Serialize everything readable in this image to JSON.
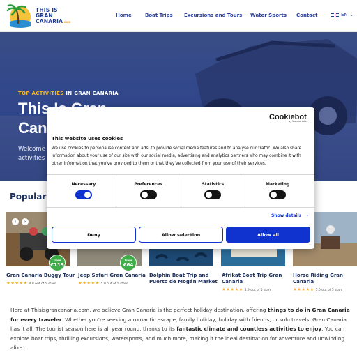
{
  "header": {
    "logo": {
      "line1": "THIS IS",
      "line2": "GRAN",
      "line3": "CANARIA",
      "suffix": ".com"
    },
    "nav": [
      "Home",
      "Boat Trips",
      "Excursions and Tours",
      "Water Sports",
      "Contact"
    ],
    "language": "EN"
  },
  "hero": {
    "kicker_accent": "TOP ACTIVITIES",
    "kicker_rest": " IN GRAN CANARIA",
    "title_line1": "This Is Gran",
    "title_line2": "Canaria",
    "subtitle_line1": "Welcome to",
    "subtitle_line2": "activities in"
  },
  "popular": {
    "title": "Popular Activities",
    "cards": [
      {
        "title_line1": "Gran Canaria Buggy Tour",
        "title_line2": "",
        "stars": "★★★★★",
        "rating": "4.8 out of 5 stars",
        "price_from": "from",
        "price": "€119"
      },
      {
        "title_line1": "Jeep Safari Gran Canaria",
        "title_line2": "",
        "stars": "★★★★★",
        "rating": "5.0 out of 5 stars",
        "price_from": "from",
        "price": "€64"
      },
      {
        "title_line1": "Dolphin Boat Trip and",
        "title_line2": "Puerto de Mogán Market",
        "stars": "",
        "rating": "",
        "price_from": "",
        "price": ""
      },
      {
        "title_line1": "Afrikat Boat Trip Gran",
        "title_line2": "Canaria",
        "stars": "★★★★★",
        "rating": "4.9 out of 5 stars",
        "price_from": "",
        "price": ""
      },
      {
        "title_line1": "Horse Riding Gran",
        "title_line2": "Canaria",
        "stars": "★★★★★",
        "rating": "5.0 out of 5 stars",
        "price_from": "",
        "price": ""
      }
    ]
  },
  "intro": {
    "p1": "Here at Thisisgrancanaria.com, we believe Gran Canaria is the perfect holiday destination, offering ",
    "b1": "things to do in Gran Canaria for every traveler",
    "p2": ". Whether you're seeking a romantic escape, family holiday, holiday with friends, or solo travels, Gran Canaria has it all. The tourist season here is all year round, thanks to its ",
    "b2": "fantastic climate and countless activities to enjoy",
    "p3": ". You can explore boat trips, thrilling excursions, watersports, and much more, making it the ideal destination for adventure and unwinding alike."
  },
  "cookie": {
    "brand": "Cookiebot",
    "brand_sub": "by Usercentrics",
    "title": "This website uses cookies",
    "text": "We use cookies to personalise content and ads, to provide social media features and to analyse our traffic. We also share information about your use of our site with our social media, advertising and analytics partners who may combine it with other information that you've provided to them or that they've collected from your use of their services.",
    "toggles": [
      {
        "label": "Necessary",
        "on": true
      },
      {
        "label": "Preferences",
        "on": false
      },
      {
        "label": "Statistics",
        "on": false
      },
      {
        "label": "Marketing",
        "on": false
      }
    ],
    "show_details": "Show details",
    "buttons": {
      "deny": "Deny",
      "allow_selection": "Allow selection",
      "allow_all": "Allow all"
    },
    "colors": {
      "accent": "#1032cf"
    }
  }
}
